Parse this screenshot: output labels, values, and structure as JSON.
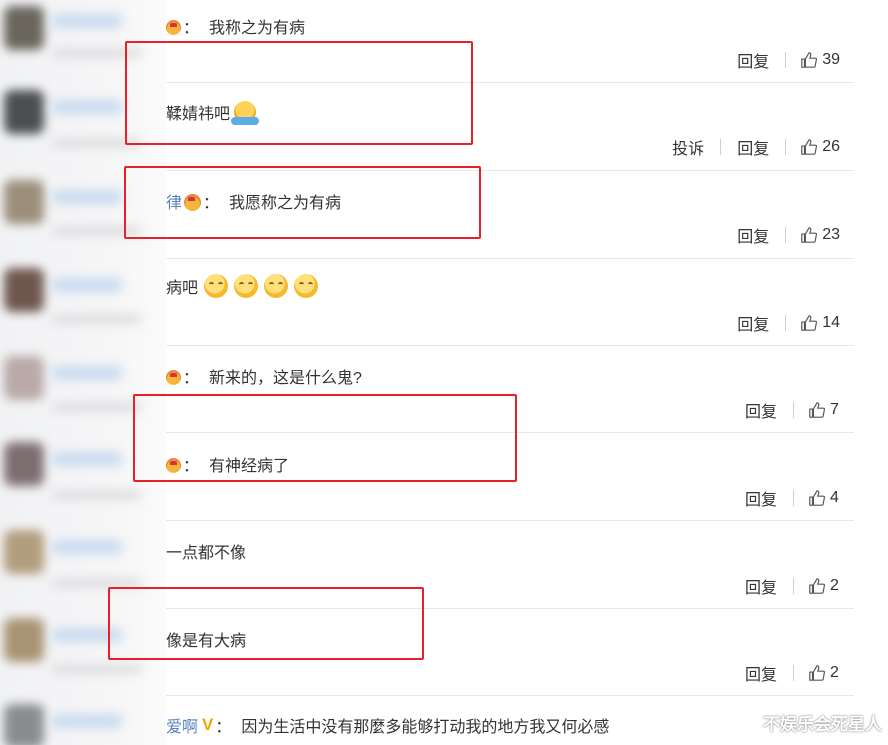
{
  "comments": [
    {
      "text": "我称之为有病",
      "actions": [
        "回复"
      ],
      "likes": "39"
    },
    {
      "text": "鞣婧祎吧",
      "actions": [
        "投诉",
        "回复"
      ],
      "likes": "26"
    },
    {
      "user_fragment": "律",
      "text": "我愿称之为有病",
      "actions": [
        "回复"
      ],
      "likes": "23"
    },
    {
      "text": "病吧",
      "actions": [
        "回复"
      ],
      "likes": "14"
    },
    {
      "text": "新来的，这是什么鬼?",
      "actions": [
        "回复"
      ],
      "likes": "7"
    },
    {
      "text": "有神经病了",
      "actions": [
        "回复"
      ],
      "likes": "4"
    },
    {
      "text": "一点都不像",
      "actions": [
        "回复"
      ],
      "likes": "2"
    },
    {
      "text": "像是有大病",
      "actions": [
        "回复"
      ],
      "likes": "2"
    },
    {
      "user_fragment": "爱啊",
      "text": "因为生活中没有那麼多能够打动我的地方我又何必感"
    }
  ],
  "colon": "：",
  "watermark": "不娱乐会死星人",
  "colors": {
    "highlight_box": "#e8202a",
    "username": "#5a7fbf",
    "verified": "#f0a800"
  }
}
